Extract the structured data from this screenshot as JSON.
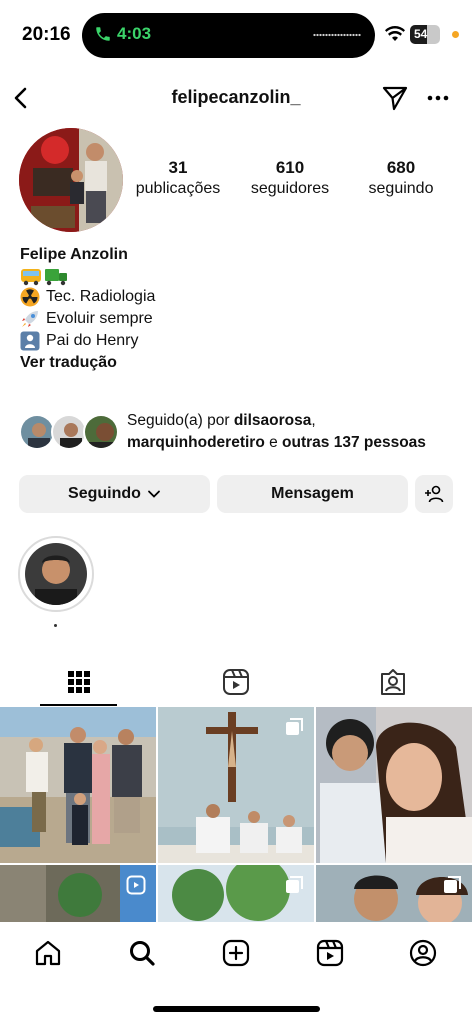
{
  "status_bar": {
    "time": "20:16",
    "call_timer": "4:03",
    "battery_level": "54",
    "icons": [
      "phone-icon",
      "wifi-icon",
      "battery-icon"
    ]
  },
  "header": {
    "username": "felipecanzolin_",
    "icons": [
      "back-arrow-icon",
      "direct-message-icon",
      "more-options-icon"
    ]
  },
  "profile": {
    "stats": [
      {
        "value": "31",
        "label": "publicações"
      },
      {
        "value": "610",
        "label": "seguidores"
      },
      {
        "value": "680",
        "label": "seguindo"
      }
    ]
  },
  "bio": {
    "name": "Felipe Anzolin",
    "lines": [
      {
        "icon": "bus-truck-emoji",
        "text": ""
      },
      {
        "icon": "radioactive-emoji",
        "text": "Tec. Radiologia"
      },
      {
        "icon": "rocket-emoji",
        "text": "Evoluir sempre"
      },
      {
        "icon": "baby-emoji",
        "text": "Pai do Henry"
      }
    ],
    "translate": "Ver tradução"
  },
  "followed_by": {
    "prefix": "Seguido(a) por ",
    "user1": "dilsaorosa",
    "separator": ",",
    "user2": "marquinhoderetiro",
    "conj": " e ",
    "others": "outras 137 pessoas"
  },
  "actions": {
    "following": "Seguindo",
    "message": "Mensagem"
  },
  "tabs": [
    "grid-icon",
    "reels-icon",
    "tagged-icon"
  ],
  "colors": {
    "accent": "#3bd46a",
    "button_bg": "#efefef",
    "recording_dot": "#f5a623"
  },
  "bottom_nav": [
    "home-icon",
    "search-icon",
    "create-icon",
    "reels-nav-icon",
    "profile-icon"
  ]
}
